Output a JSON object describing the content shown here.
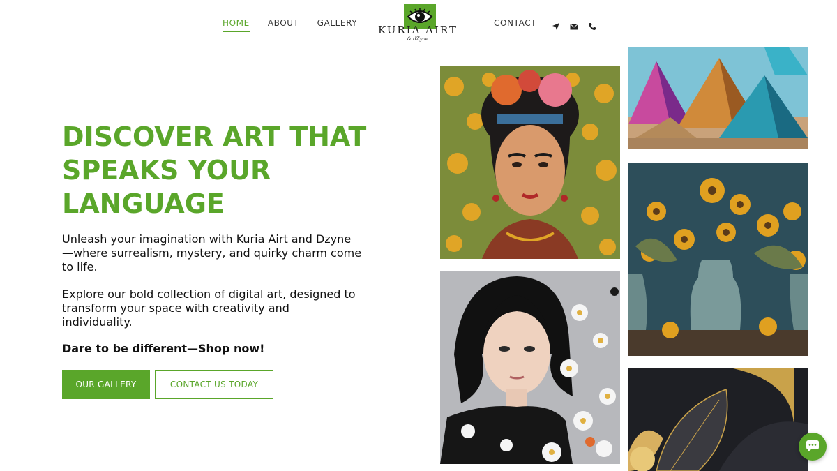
{
  "nav": {
    "home": "HOME",
    "about": "ABOUT",
    "gallery": "GALLERY",
    "contact": "CONTACT",
    "icons": [
      "location-arrow-icon",
      "envelope-icon",
      "phone-icon"
    ]
  },
  "logo": {
    "name": "KURIA AIRT",
    "sub": "& dZyne"
  },
  "hero": {
    "headline_lines": [
      "DISCOVER ART THAT",
      "SPEAKS YOUR",
      "LANGUAGE"
    ],
    "paragraph1": "Unleash your imagination with Kuria Airt and Dzyne—where surrealism, mystery, and quirky charm come to life.",
    "paragraph2": "Explore our bold collection of digital art, designed to transform your space with creativity and individuality.",
    "cta": "Dare to be different—Shop now!",
    "button_primary": "OUR GALLERY",
    "button_secondary": "CONTACT US TODAY"
  },
  "gallery": {
    "tiles": [
      "portrait-flower-crown-artwork",
      "colorful-pyramids-artwork",
      "sunflowers-in-vases-artwork",
      "girl-with-daisies-artwork",
      "gold-leaves-artwork"
    ]
  },
  "colors": {
    "accent": "#5aa62a",
    "text": "#111111",
    "nav_text": "#333333"
  },
  "chat_icon": "chat-bubble-icon"
}
